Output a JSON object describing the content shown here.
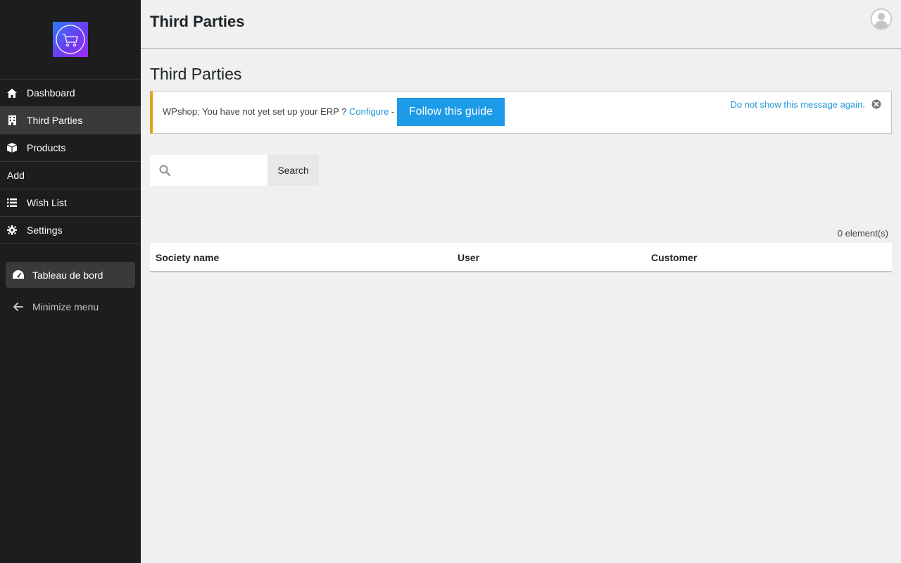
{
  "sidebar": {
    "items": [
      {
        "label": "Dashboard",
        "icon": "home-icon"
      },
      {
        "label": "Third Parties",
        "icon": "building-icon",
        "active": true
      },
      {
        "label": "Products",
        "icon": "box-icon"
      },
      {
        "label": "Add"
      },
      {
        "label": "Wish List",
        "icon": "list-icon"
      },
      {
        "label": "Settings",
        "icon": "gear-icon"
      }
    ],
    "tableau_label": "Tableau de bord",
    "minimize_label": "Minimize menu"
  },
  "header": {
    "title": "Third Parties"
  },
  "main": {
    "page_title": "Third Parties",
    "notice": {
      "text": "WPshop: You have not yet set up your ERP ? ",
      "configure_link": "Configure",
      "separator": " -",
      "guide_button": "Follow this guide",
      "dismiss_link": "Do not show this message again."
    },
    "search": {
      "placeholder": "",
      "button_label": "Search"
    },
    "count": "0 element(s)",
    "table": {
      "columns": [
        "Society name",
        "User",
        "Customer"
      ]
    }
  },
  "colors": {
    "sidebar_bg": "#1d1d1d",
    "accent_button": "#1e9be8",
    "link": "#2196d8",
    "notice_border": "#dba617"
  }
}
